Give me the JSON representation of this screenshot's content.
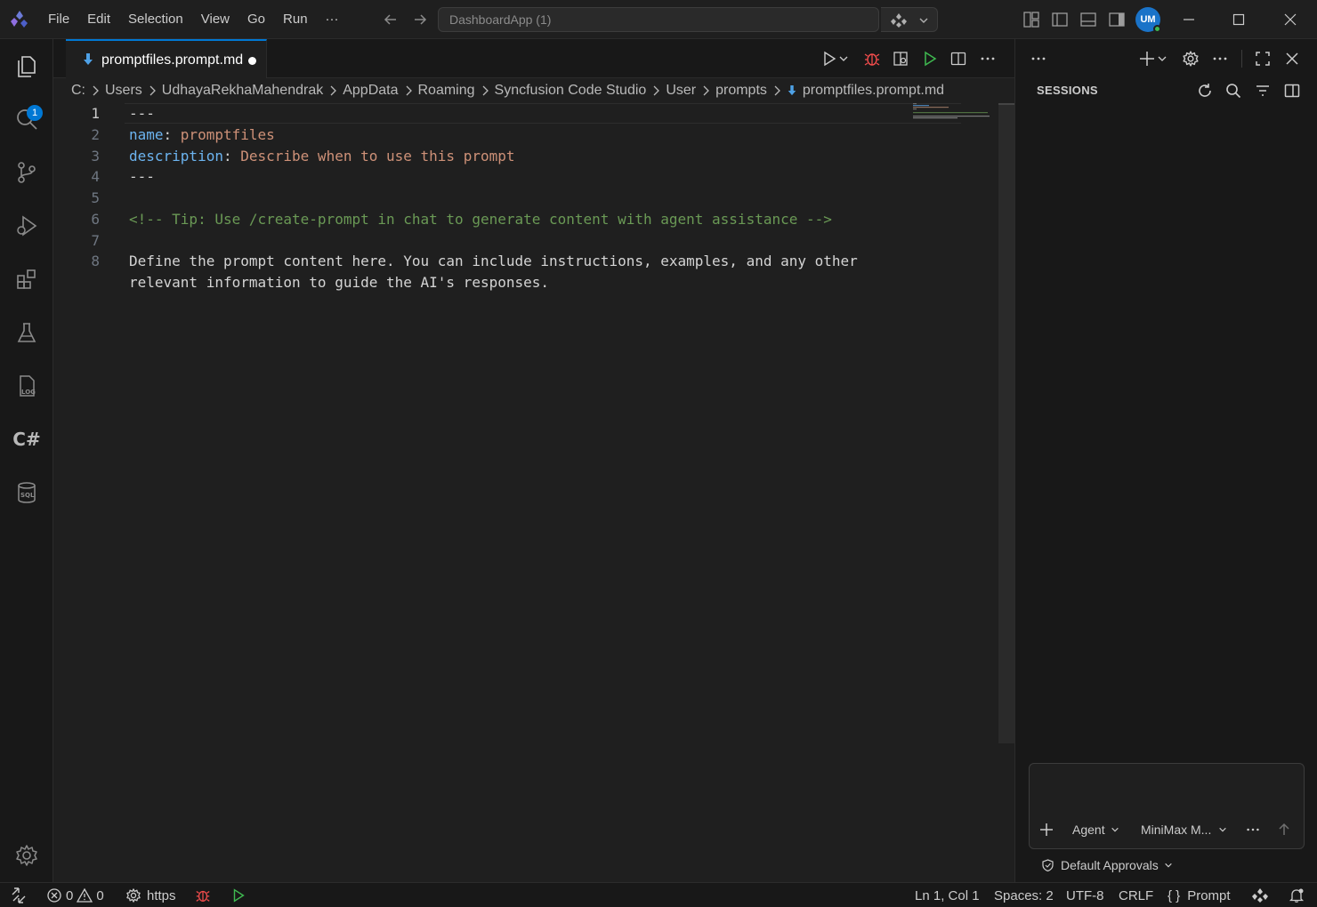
{
  "titlebar": {
    "menu": [
      "File",
      "Edit",
      "Selection",
      "View",
      "Go",
      "Run",
      "···"
    ],
    "command_center": "DashboardApp (1)",
    "avatar_initials": "UM"
  },
  "activity": {
    "explorer_badge": "1",
    "csharp_label": "C#"
  },
  "editor": {
    "tab_label": "promptfiles.prompt.md",
    "breadcrumb": [
      "C:",
      "Users",
      "UdhayaRekhaMahendrak",
      "AppData",
      "Roaming",
      "Syncfusion Code Studio",
      "User",
      "prompts"
    ],
    "breadcrumb_file": "promptfiles.prompt.md",
    "line_numbers": [
      "1",
      "2",
      "3",
      "4",
      "5",
      "6",
      "7",
      "8"
    ],
    "lines": {
      "l1": "---",
      "l2_key": "name",
      "l2_colon": ": ",
      "l2_val": "promptfiles",
      "l3_key": "description",
      "l3_colon": ": ",
      "l3_val": "Describe when to use this prompt",
      "l4": "---",
      "l6": "<!-- Tip: Use /create-prompt in chat to generate content with agent assistance -->",
      "l8a": "Define the prompt content here. You can include instructions, examples, and any other",
      "l8b": "relevant information to guide the AI's responses."
    }
  },
  "sidepanel": {
    "title": "SESSIONS",
    "mode": "Agent",
    "model": "MiniMax M...",
    "approvals": "Default Approvals"
  },
  "statusbar": {
    "errors": "0",
    "warnings": "0",
    "remote": "https",
    "position": "Ln 1, Col 1",
    "spaces": "Spaces: 2",
    "encoding": "UTF-8",
    "eol": "CRLF",
    "language_braces": "{ }",
    "language": "Prompt"
  },
  "colors": {
    "accent": "#0078d4",
    "keyword": "#6cb4f0",
    "string": "#ce9178",
    "comment": "#6a9955",
    "debug": "#f14c4c",
    "run": "#3fb950"
  }
}
